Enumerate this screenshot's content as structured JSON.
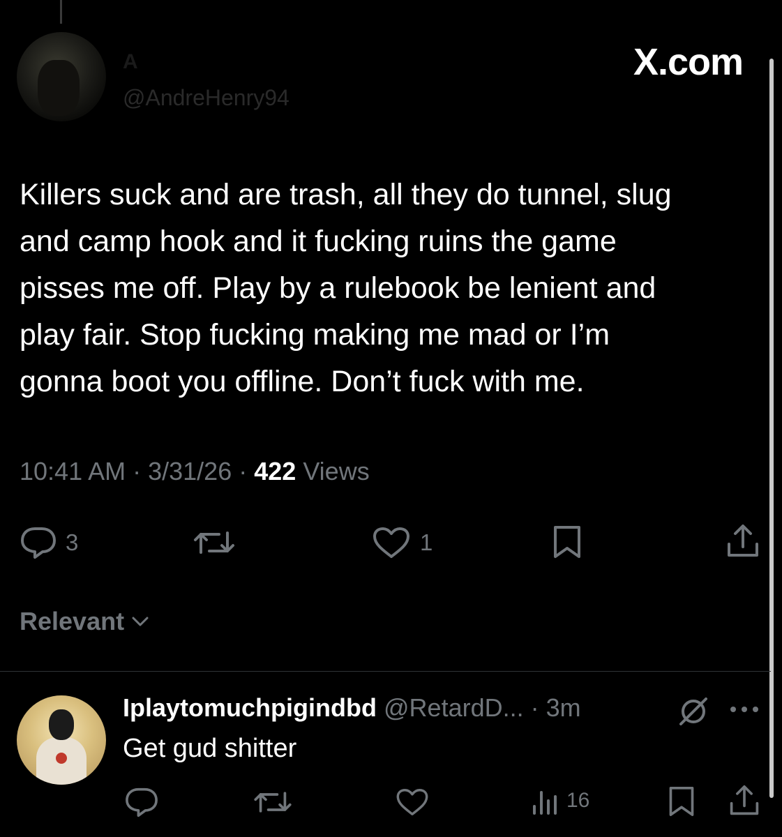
{
  "brand": {
    "label": "X.com"
  },
  "tweet": {
    "author_name": "A",
    "author_handle": "@AndreHenry94",
    "text": "Killers suck and are trash, all they do tunnel, slug\nand camp hook and it fucking ruins the game\npisses me off. Play by a rulebook be lenient and\nplay fair. Stop fucking making me mad or I’m\ngonna boot you offline. Don’t fuck with me.",
    "time": "10:41 AM",
    "dot1": " · ",
    "date": "3/31/26",
    "dot2": " · ",
    "views_count": "422",
    "views_label": " Views",
    "actions": {
      "reply_icon": "reply-bubble-icon",
      "reply_count": "3",
      "repost_icon": "repost-icon",
      "like_icon": "heart-icon",
      "like_count": "1",
      "bookmark_icon": "bookmark-icon",
      "share_icon": "share-icon"
    }
  },
  "sort": {
    "label": "Relevant",
    "icon": "chevron-down-icon"
  },
  "reply": {
    "author_name": "Iplaytomuchpigindbd",
    "author_handle": "@RetardD...",
    "separator": " · ",
    "time": "3m",
    "text": "Get gud shitter",
    "mute_icon": "mute-slash-icon",
    "more_icon": "more-dots-icon",
    "actions": {
      "reply_icon": "reply-bubble-icon",
      "repost_icon": "repost-icon",
      "like_icon": "heart-icon",
      "views_icon": "analytics-icon",
      "views_count": "16",
      "bookmark_icon": "bookmark-icon",
      "share_icon": "share-icon"
    }
  },
  "colors": {
    "background": "#000000",
    "text_primary": "#ffffff",
    "text_secondary": "#71767b",
    "divider": "#2f3336"
  }
}
